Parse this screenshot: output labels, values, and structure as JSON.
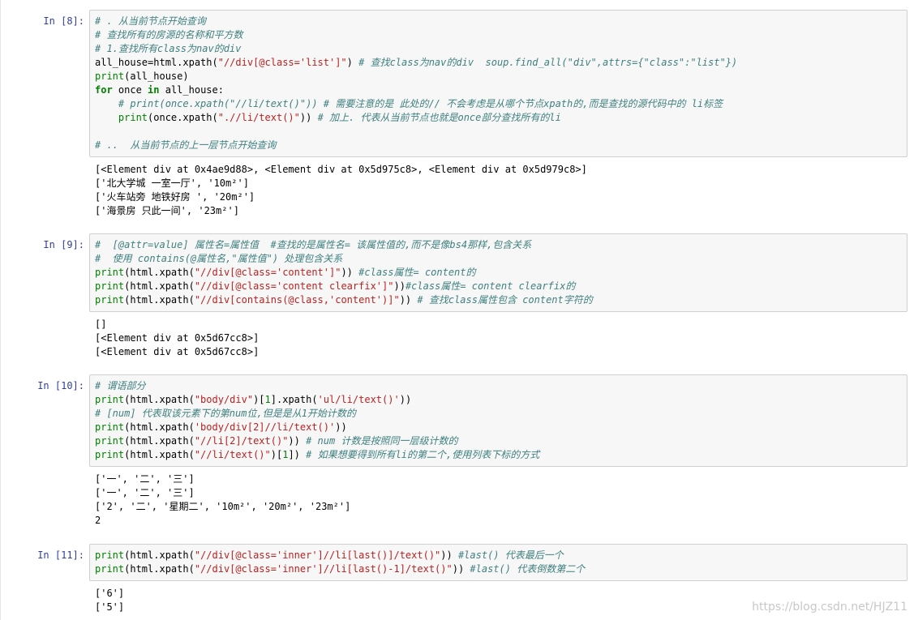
{
  "cells": [
    {
      "prompt": "In  [8]:",
      "input": [
        [
          [
            "cm",
            "# . 从当前节点开始查询"
          ]
        ],
        [
          [
            "cm",
            "# 查找所有的房源的名称和平方数"
          ]
        ],
        [
          [
            "cm",
            "# 1.查找所有class为nav的div"
          ]
        ],
        [
          [
            "",
            "all_house=html.xpath("
          ],
          [
            "st",
            "\"//div[@class='list']\""
          ],
          [
            "",
            ") "
          ],
          [
            "cm",
            "# 查找class为nav的div  soup.find_all(\"div\",attrs={\"class\":\"list\"})"
          ]
        ],
        [
          [
            "bi",
            "print"
          ],
          [
            "",
            "(all_house)"
          ]
        ],
        [
          [
            "kw",
            "for"
          ],
          [
            "",
            " once "
          ],
          [
            "kw",
            "in"
          ],
          [
            "",
            " all_house:"
          ]
        ],
        [
          [
            "",
            "    "
          ],
          [
            "cm",
            "# print(once.xpath(\"//li/text()\")) # 需要注意的是 此处的// 不会考虑是从哪个节点xpath的,而是查找的源代码中的 li标签"
          ]
        ],
        [
          [
            "",
            "    "
          ],
          [
            "bi",
            "print"
          ],
          [
            "",
            "(once.xpath("
          ],
          [
            "st",
            "\".//li/text()\""
          ],
          [
            "",
            ")) "
          ],
          [
            "cm",
            "# 加上. 代表从当前节点也就是once部分查找所有的li"
          ]
        ],
        [
          [
            "",
            ""
          ]
        ],
        [
          [
            "cm",
            "# ..  从当前节点的上一层节点开始查询"
          ]
        ]
      ],
      "output": [
        "[<Element div at 0x4ae9d88>, <Element div at 0x5d975c8>, <Element div at 0x5d979c8>]",
        "['北大学城 一室一厅', '10m²']",
        "['火车站旁 地铁好房 ', '20m²']",
        "['海景房 只此一间', '23m²']"
      ]
    },
    {
      "prompt": "In  [9]:",
      "input": [
        [
          [
            "cm",
            "#  [@attr=value] 属性名=属性值  #查找的是属性名= 该属性值的,而不是像bs4那样,包含关系"
          ]
        ],
        [
          [
            "cm",
            "#  使用 contains(@属性名,\"属性值\") 处理包含关系"
          ]
        ],
        [
          [
            "bi",
            "print"
          ],
          [
            "",
            "(html.xpath("
          ],
          [
            "st",
            "\"//div[@class='content']\""
          ],
          [
            "",
            ")) "
          ],
          [
            "cm",
            "#class属性= content的"
          ]
        ],
        [
          [
            "bi",
            "print"
          ],
          [
            "",
            "(html.xpath("
          ],
          [
            "st",
            "\"//div[@class='content clearfix']\""
          ],
          [
            "",
            "))"
          ],
          [
            "cm",
            "#class属性= content clearfix的"
          ]
        ],
        [
          [
            "bi",
            "print"
          ],
          [
            "",
            "(html.xpath("
          ],
          [
            "st",
            "\"//div[contains(@class,'content')]\""
          ],
          [
            "",
            ")) "
          ],
          [
            "cm",
            "# 查找class属性包含 content字符的"
          ]
        ]
      ],
      "output": [
        "[]",
        "[<Element div at 0x5d67cc8>]",
        "[<Element div at 0x5d67cc8>]"
      ]
    },
    {
      "prompt": "In  [10]:",
      "input": [
        [
          [
            "cm",
            "# 谓语部分"
          ]
        ],
        [
          [
            "bi",
            "print"
          ],
          [
            "",
            "(html.xpath("
          ],
          [
            "st",
            "\"body/div\""
          ],
          [
            "",
            ")["
          ],
          [
            "nm",
            "1"
          ],
          [
            "",
            "].xpath("
          ],
          [
            "st",
            "'ul/li/text()'"
          ],
          [
            "",
            "))"
          ]
        ],
        [
          [
            "cm",
            "# [num] 代表取该元素下的第num位,但是是从1开始计数的"
          ]
        ],
        [
          [
            "bi",
            "print"
          ],
          [
            "",
            "(html.xpath("
          ],
          [
            "st",
            "'body/div[2]//li/text()'"
          ],
          [
            "",
            "))"
          ]
        ],
        [
          [
            "bi",
            "print"
          ],
          [
            "",
            "(html.xpath("
          ],
          [
            "st",
            "\"//li[2]/text()\""
          ],
          [
            "",
            ")) "
          ],
          [
            "cm",
            "# num 计数是按照同一层级计数的"
          ]
        ],
        [
          [
            "bi",
            "print"
          ],
          [
            "",
            "(html.xpath("
          ],
          [
            "st",
            "\"//li/text()\""
          ],
          [
            "",
            ")["
          ],
          [
            "nm",
            "1"
          ],
          [
            "",
            "]) "
          ],
          [
            "cm",
            "# 如果想要得到所有li的第二个,使用列表下标的方式"
          ]
        ]
      ],
      "output": [
        "['一', '二', '三']",
        "['一', '二', '三']",
        "['2', '二', '星期二', '10m²', '20m²', '23m²']",
        "2"
      ]
    },
    {
      "prompt": "In  [11]:",
      "input": [
        [
          [
            "bi",
            "print"
          ],
          [
            "",
            "(html.xpath("
          ],
          [
            "st",
            "\"//div[@class='inner']//li[last()]/text()\""
          ],
          [
            "",
            ")) "
          ],
          [
            "cm",
            "#last() 代表最后一个"
          ]
        ],
        [
          [
            "bi",
            "print"
          ],
          [
            "",
            "(html.xpath("
          ],
          [
            "st",
            "\"//div[@class='inner']//li[last()-1]/text()\""
          ],
          [
            "",
            ")) "
          ],
          [
            "cm",
            "#last() 代表倒数第二个"
          ]
        ]
      ],
      "output": [
        "['6']",
        "['5']"
      ]
    }
  ],
  "watermark": "https://blog.csdn.net/HJZ11"
}
